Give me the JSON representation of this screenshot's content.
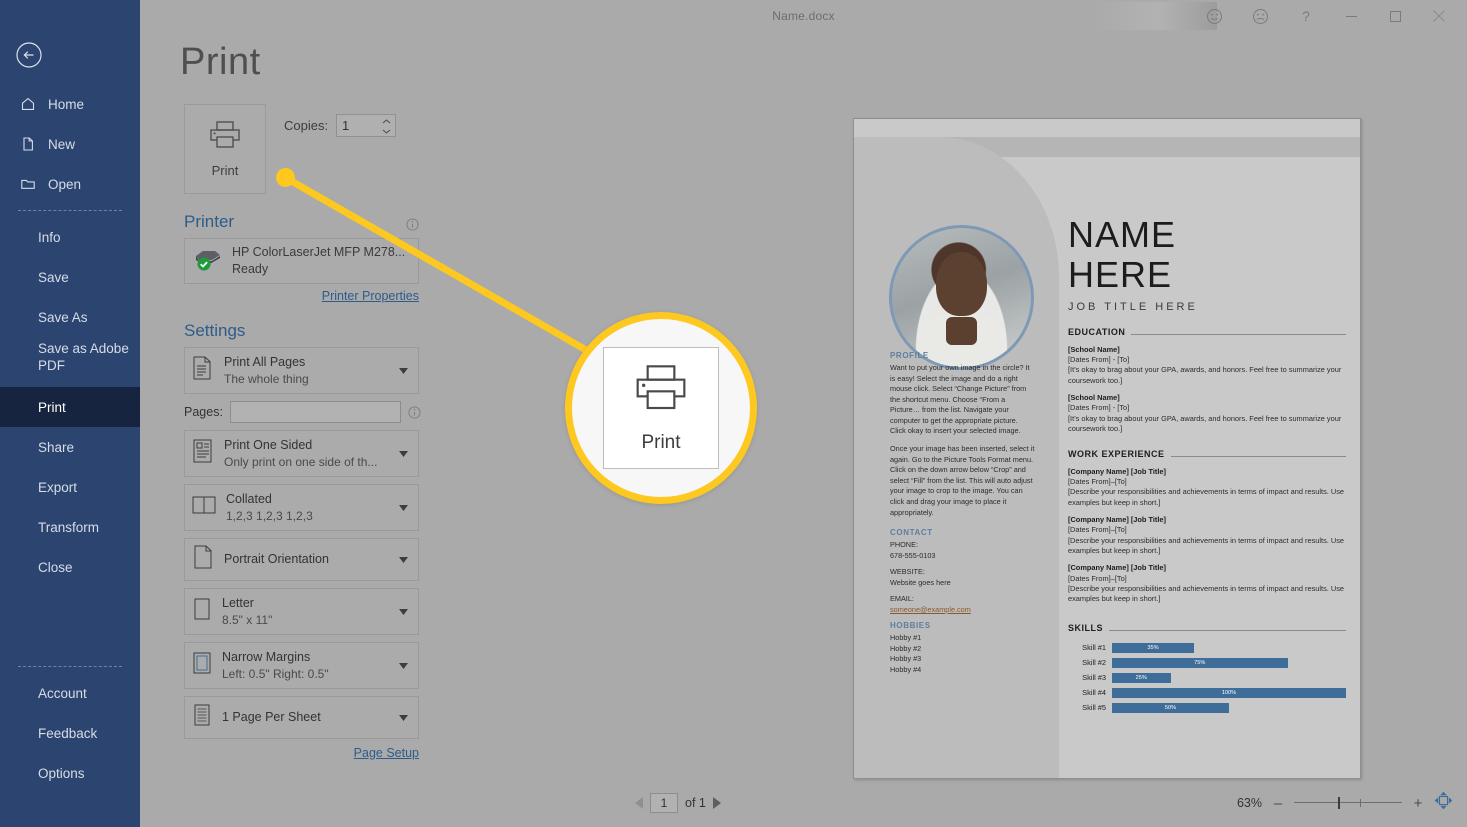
{
  "window": {
    "title": "Name.docx",
    "controls": {
      "happy": "happy-face",
      "sad": "sad-face",
      "help": "?",
      "minimize": "—",
      "maximize": "□",
      "close": "✕"
    }
  },
  "sidebar": {
    "back": "back-arrow",
    "items": [
      {
        "label": "Home",
        "icon": "home-icon",
        "indent": false,
        "active": false
      },
      {
        "label": "New",
        "icon": "file-icon",
        "indent": false,
        "active": false
      },
      {
        "label": "Open",
        "icon": "folder-icon",
        "indent": false,
        "active": false
      },
      {
        "label": "Info",
        "icon": "",
        "indent": true,
        "active": false
      },
      {
        "label": "Save",
        "icon": "",
        "indent": true,
        "active": false
      },
      {
        "label": "Save As",
        "icon": "",
        "indent": true,
        "active": false
      },
      {
        "label": "Save as Adobe PDF",
        "icon": "",
        "indent": true,
        "active": false
      },
      {
        "label": "Print",
        "icon": "",
        "indent": true,
        "active": true
      },
      {
        "label": "Share",
        "icon": "",
        "indent": true,
        "active": false
      },
      {
        "label": "Export",
        "icon": "",
        "indent": true,
        "active": false
      },
      {
        "label": "Transform",
        "icon": "",
        "indent": true,
        "active": false
      },
      {
        "label": "Close",
        "icon": "",
        "indent": true,
        "active": false
      }
    ],
    "bottom_items": [
      {
        "label": "Account"
      },
      {
        "label": "Feedback"
      },
      {
        "label": "Options"
      }
    ]
  },
  "print": {
    "page_title": "Print",
    "print_button_label": "Print",
    "copies_label": "Copies:",
    "copies_value": "1",
    "printer_heading": "Printer",
    "printer_name": "HP ColorLaserJet MFP M278...",
    "printer_status": "Ready",
    "printer_properties_link": "Printer Properties",
    "settings_heading": "Settings",
    "pages_label": "Pages:",
    "pages_value": "",
    "page_setup_link": "Page Setup",
    "options": [
      {
        "icon": "pages-icon",
        "title": "Print All Pages",
        "subtitle": "The whole thing"
      },
      {
        "icon": "one-sided-icon",
        "title": "Print One Sided",
        "subtitle": "Only print on one side of th..."
      },
      {
        "icon": "collate-icon",
        "title": "Collated",
        "subtitle": "1,2,3   1,2,3   1,2,3"
      },
      {
        "icon": "portrait-icon",
        "title": "Portrait Orientation",
        "subtitle": ""
      },
      {
        "icon": "paper-size-icon",
        "title": "Letter",
        "subtitle": "8.5\" x 11\""
      },
      {
        "icon": "margins-icon",
        "title": "Narrow Margins",
        "subtitle": "Left:  0.5\"   Right:  0.5\""
      },
      {
        "icon": "per-sheet-icon",
        "title": "1 Page Per Sheet",
        "subtitle": ""
      }
    ]
  },
  "callout": {
    "label": "Print",
    "icon": "printer-icon",
    "highlight_color": "#fdc81f"
  },
  "status": {
    "page_value": "1",
    "page_of": "of 1",
    "zoom_level": "63%",
    "zoom_minus": "–",
    "zoom_plus": "+",
    "zoom_to_page": "zoom-to-page-icon"
  },
  "document": {
    "name_line1": "NAME",
    "name_line2": "HERE",
    "job_title": "JOB TITLE HERE",
    "left_column": {
      "profile_heading": "PROFILE",
      "profile_p1": "Want to put your own image in the circle?  It is easy!  Select the image and do a right mouse click.  Select “Change Picture” from the shortcut menu.  Choose “From a Picture… from the list.  Navigate your computer to get the appropriate picture.  Click okay to insert your selected image.",
      "profile_p2": "Once your image has been inserted, select it again.  Go to the Picture Tools Format menu. Click on the down arrow below “Crop” and select “Fill” from the list.  This will auto adjust your image to crop to the image.  You can click and drag your image to place it appropriately.",
      "contact_heading": "CONTACT",
      "phone_label": "PHONE:",
      "phone_value": "678-555-0103",
      "website_label": "WEBSITE:",
      "website_value": "Website goes here",
      "email_label": "EMAIL:",
      "email_value": "someone@example.com",
      "hobbies_heading": "HOBBIES",
      "hobbies": [
        "Hobby #1",
        "Hobby #2",
        "Hobby #3",
        "Hobby #4"
      ]
    },
    "education": {
      "heading": "EDUCATION",
      "entries": [
        {
          "school": "[School Name]",
          "dates": "[Dates From] - [To]",
          "desc": "[It’s okay to brag about your GPA, awards, and honors. Feel free to summarize your coursework too.]"
        },
        {
          "school": "[School Name]",
          "dates": "[Dates From] - [To]",
          "desc": "[It’s okay to brag about your GPA, awards, and honors. Feel free to summarize your coursework too.]"
        }
      ]
    },
    "work": {
      "heading": "WORK EXPERIENCE",
      "entries": [
        {
          "company": "[Company Name]  [Job Title]",
          "dates": "[Dates From]–[To]",
          "desc": "[Describe your responsibilities and achievements in terms of impact and results. Use examples but keep in short.]"
        },
        {
          "company": "[Company Name]  [Job Title]",
          "dates": "[Dates From]–[To]",
          "desc": "[Describe your responsibilities and achievements in terms of impact and results. Use examples but keep in short.]"
        },
        {
          "company": "[Company Name]  [Job Title]",
          "dates": "[Dates From]–[To]",
          "desc": "[Describe your responsibilities and achievements in terms of impact and results. Use examples but keep in short.]"
        }
      ]
    },
    "skills": {
      "heading": "SKILLS",
      "bar_color": "#3f6d9a",
      "items": [
        {
          "name": "Skill #1",
          "value": 35,
          "label": "35%"
        },
        {
          "name": "Skill #2",
          "value": 75,
          "label": "75%"
        },
        {
          "name": "Skill #3",
          "value": 25,
          "label": "25%"
        },
        {
          "name": "Skill #4",
          "value": 100,
          "label": "100%"
        },
        {
          "name": "Skill #5",
          "value": 50,
          "label": "50%"
        }
      ]
    }
  }
}
